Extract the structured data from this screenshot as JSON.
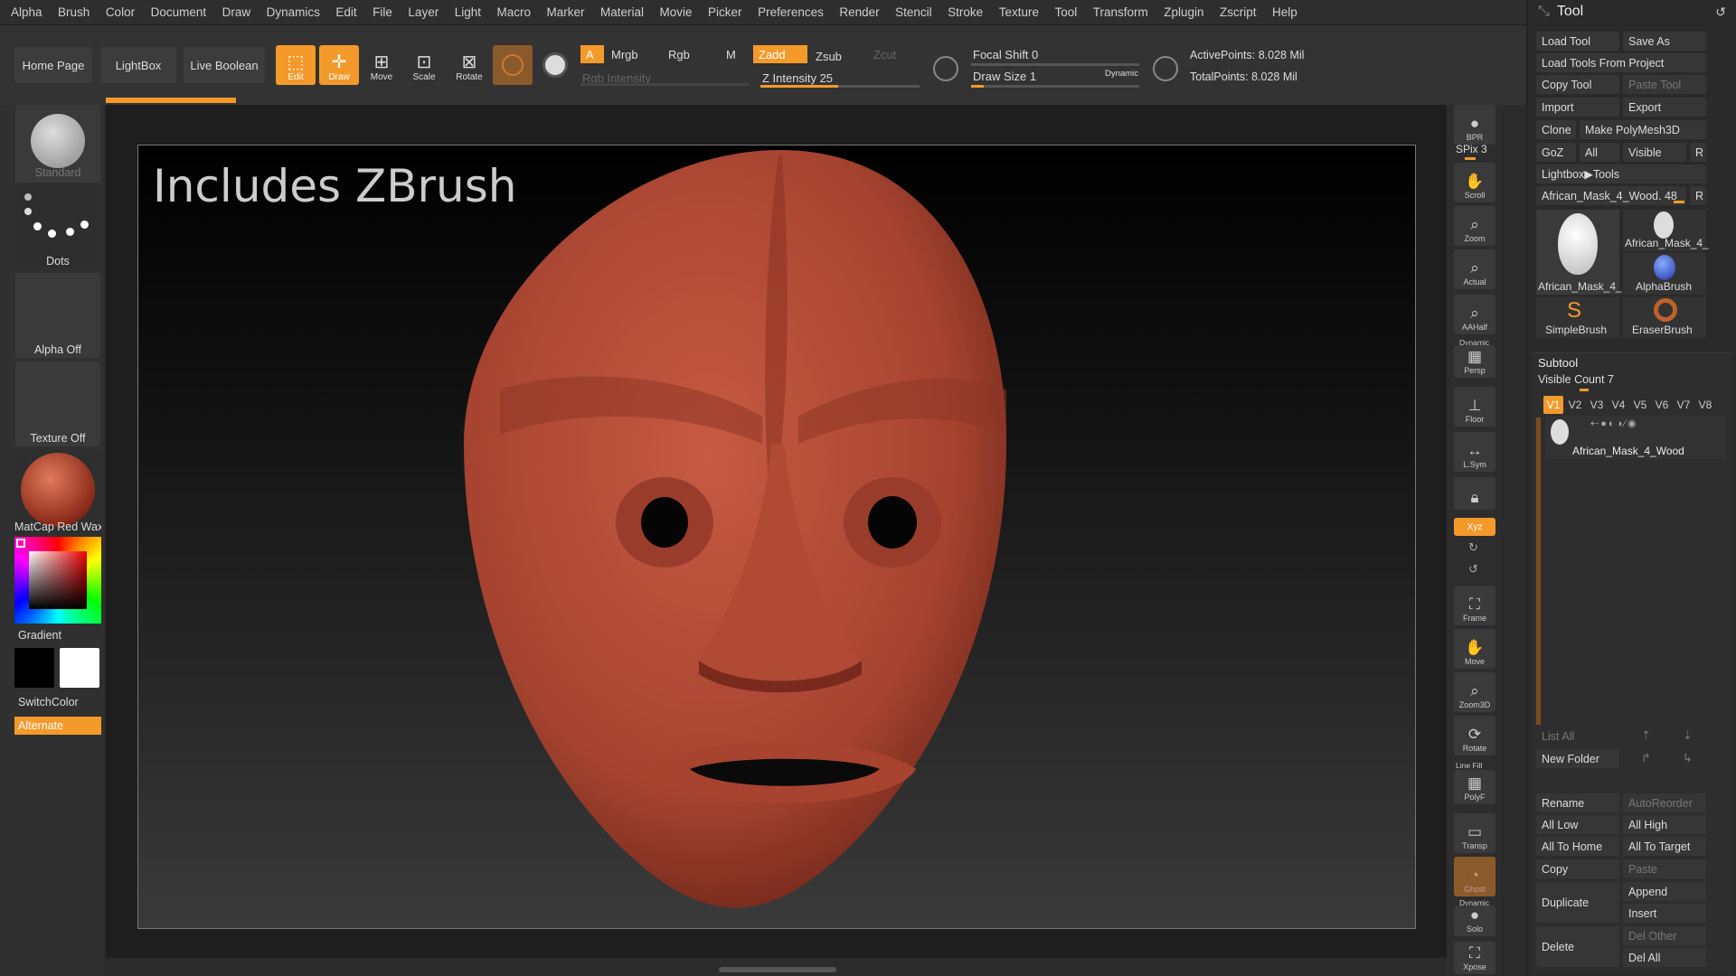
{
  "menu": [
    "Alpha",
    "Brush",
    "Color",
    "Document",
    "Draw",
    "Dynamics",
    "Edit",
    "File",
    "Layer",
    "Light",
    "Macro",
    "Marker",
    "Material",
    "Movie",
    "Picker",
    "Preferences",
    "Render",
    "Stencil",
    "Stroke",
    "Texture",
    "Tool",
    "Transform",
    "Zplugin",
    "Zscript",
    "Help"
  ],
  "topbar": {
    "home": "Home Page",
    "lightbox": "LightBox",
    "live_boolean": "Live Boolean",
    "tools": {
      "edit": "Edit",
      "draw": "Draw",
      "move": "Move",
      "scale": "Scale",
      "rotate": "Rotate"
    },
    "a_label": "A",
    "mrgb": "Mrgb",
    "rgb": "Rgb",
    "m": "M",
    "zadd": "Zadd",
    "zsub": "Zsub",
    "zcut": "Zcut",
    "rgb_intensity": "Rgb Intensity",
    "z_intensity": "Z Intensity 25",
    "focal_shift": "Focal Shift 0",
    "draw_size": "Draw Size 1",
    "dynamic": "Dynamic",
    "active_points": "ActivePoints: 8.028 Mil",
    "total_points": "TotalPoints: 8.028 Mil"
  },
  "left": {
    "brush": "Standard",
    "stroke": "Dots",
    "alpha": "Alpha Off",
    "texture": "Texture Off",
    "material": "MatCap Red Wax",
    "gradient": "Gradient",
    "switch_color": "SwitchColor",
    "alternate": "Alternate"
  },
  "canvas": {
    "overlay": "Includes ZBrush"
  },
  "right_tools": {
    "bpr": "BPR",
    "spix": "SPix 3",
    "scroll": "Scroll",
    "zoom": "Zoom",
    "actual": "Actual",
    "aahalf": "AAHalf",
    "dynamic": "Dynamic",
    "persp": "Persp",
    "floor": "Floor",
    "lsym": "L.Sym",
    "xyz": "Xyz",
    "frame": "Frame",
    "move": "Move",
    "zoom3d": "Zoom3D",
    "rotate": "Rotate",
    "line_fill": "Line Fill",
    "polyf": "PolyF",
    "transp": "Transp",
    "ghost": "Ghost",
    "dynamic2": "Dynamic",
    "solo": "Solo",
    "xpose": "Xpose"
  },
  "tool_panel": {
    "title": "Tool",
    "load_tool": "Load Tool",
    "save_as": "Save As",
    "load_from_project": "Load Tools From Project",
    "copy_tool": "Copy Tool",
    "paste_tool": "Paste Tool",
    "import": "Import",
    "export": "Export",
    "clone": "Clone",
    "make_polymesh": "Make PolyMesh3D",
    "goz": "GoZ",
    "all": "All",
    "visible": "Visible",
    "r": "R",
    "lightbox_tools": "Lightbox▶Tools",
    "current_tool": "African_Mask_4_Wood. 48",
    "thumbs": [
      "African_Mask_4_",
      "African_Mask_4_",
      "AlphaBrush",
      "SimpleBrush",
      "EraserBrush"
    ],
    "subtool": "Subtool",
    "visible_count": "Visible Count 7",
    "vtabs": [
      "V1",
      "V2",
      "V3",
      "V4",
      "V5",
      "V6",
      "V7",
      "V8"
    ],
    "subtool_name": "African_Mask_4_Wood",
    "list_all": "List All",
    "new_folder": "New Folder",
    "rename": "Rename",
    "autoreorder": "AutoReorder",
    "all_low": "All Low",
    "all_high": "All High",
    "all_to_home": "All To Home",
    "all_to_target": "All To Target",
    "copy": "Copy",
    "paste": "Paste",
    "duplicate": "Duplicate",
    "append": "Append",
    "insert": "Insert",
    "delete": "Delete",
    "del_other": "Del Other",
    "del_all": "Del All"
  },
  "colors": {
    "accent": "#f39a2b",
    "mask": "#b04a35"
  }
}
